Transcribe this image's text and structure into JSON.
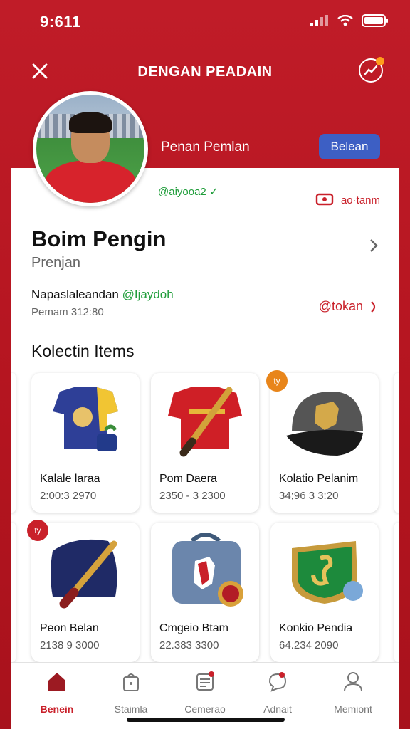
{
  "status_bar": {
    "time": "9:611"
  },
  "header": {
    "title": "DENGAN PEADAIN",
    "subtitle": "Penan Pemlan",
    "button_label": "Belean"
  },
  "profile": {
    "verified_text": "@aiyooa2 ✓",
    "action_text": "ao·tanm",
    "name": "Boim Pengin",
    "subname": "Prenjan",
    "detail_text": "Napaslaleandan",
    "detail_handle": "@Ijaydoh",
    "detail_sub": "Pemam 312:80",
    "detail_link": "@tokan"
  },
  "section_title": "Kolectin Items",
  "items": [
    {
      "title": "Kalale laraa",
      "sub": "2:00:3 2970",
      "img": "jersey-blue-icon",
      "badge": ""
    },
    {
      "title": "Pom Daera",
      "sub": "2350 - 3 2300",
      "img": "jersey-red-icon",
      "badge": ""
    },
    {
      "title": "Kolatio Pelanim",
      "sub": "34;96 3 3:20",
      "img": "cap-icon",
      "badge": "ty"
    },
    {
      "title": "Peon Belan",
      "sub": "2138 9 3000",
      "img": "scarf-icon",
      "badge": "ty"
    },
    {
      "title": "Cmgeio Btam",
      "sub": "22.383 3300",
      "img": "bag-icon",
      "badge": ""
    },
    {
      "title": "Konkio Pendia",
      "sub": "64.234 2090",
      "img": "badge-green-icon",
      "badge": ""
    }
  ],
  "tabs": [
    {
      "label": "Benein",
      "icon": "home-icon",
      "active": true
    },
    {
      "label": "Staimla",
      "icon": "bag-icon",
      "active": false
    },
    {
      "label": "Cemerao",
      "icon": "notes-icon",
      "active": false
    },
    {
      "label": "Adnait",
      "icon": "chat-icon",
      "active": false
    },
    {
      "label": "Memiont",
      "icon": "user-icon",
      "active": false
    }
  ],
  "colors": {
    "brand_red": "#c01c28",
    "accent_blue": "#3d5fc4",
    "verified_green": "#1f9d3a",
    "badge_orange": "#e8851a"
  }
}
